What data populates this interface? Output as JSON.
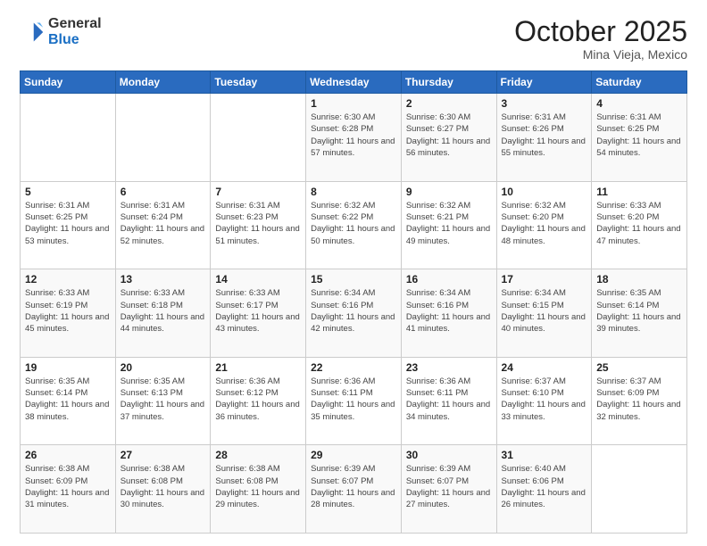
{
  "logo": {
    "general": "General",
    "blue": "Blue"
  },
  "header": {
    "month": "October 2025",
    "location": "Mina Vieja, Mexico"
  },
  "weekdays": [
    "Sunday",
    "Monday",
    "Tuesday",
    "Wednesday",
    "Thursday",
    "Friday",
    "Saturday"
  ],
  "weeks": [
    [
      {
        "day": "",
        "sunrise": "",
        "sunset": "",
        "daylight": ""
      },
      {
        "day": "",
        "sunrise": "",
        "sunset": "",
        "daylight": ""
      },
      {
        "day": "",
        "sunrise": "",
        "sunset": "",
        "daylight": ""
      },
      {
        "day": "1",
        "sunrise": "Sunrise: 6:30 AM",
        "sunset": "Sunset: 6:28 PM",
        "daylight": "Daylight: 11 hours and 57 minutes."
      },
      {
        "day": "2",
        "sunrise": "Sunrise: 6:30 AM",
        "sunset": "Sunset: 6:27 PM",
        "daylight": "Daylight: 11 hours and 56 minutes."
      },
      {
        "day": "3",
        "sunrise": "Sunrise: 6:31 AM",
        "sunset": "Sunset: 6:26 PM",
        "daylight": "Daylight: 11 hours and 55 minutes."
      },
      {
        "day": "4",
        "sunrise": "Sunrise: 6:31 AM",
        "sunset": "Sunset: 6:25 PM",
        "daylight": "Daylight: 11 hours and 54 minutes."
      }
    ],
    [
      {
        "day": "5",
        "sunrise": "Sunrise: 6:31 AM",
        "sunset": "Sunset: 6:25 PM",
        "daylight": "Daylight: 11 hours and 53 minutes."
      },
      {
        "day": "6",
        "sunrise": "Sunrise: 6:31 AM",
        "sunset": "Sunset: 6:24 PM",
        "daylight": "Daylight: 11 hours and 52 minutes."
      },
      {
        "day": "7",
        "sunrise": "Sunrise: 6:31 AM",
        "sunset": "Sunset: 6:23 PM",
        "daylight": "Daylight: 11 hours and 51 minutes."
      },
      {
        "day": "8",
        "sunrise": "Sunrise: 6:32 AM",
        "sunset": "Sunset: 6:22 PM",
        "daylight": "Daylight: 11 hours and 50 minutes."
      },
      {
        "day": "9",
        "sunrise": "Sunrise: 6:32 AM",
        "sunset": "Sunset: 6:21 PM",
        "daylight": "Daylight: 11 hours and 49 minutes."
      },
      {
        "day": "10",
        "sunrise": "Sunrise: 6:32 AM",
        "sunset": "Sunset: 6:20 PM",
        "daylight": "Daylight: 11 hours and 48 minutes."
      },
      {
        "day": "11",
        "sunrise": "Sunrise: 6:33 AM",
        "sunset": "Sunset: 6:20 PM",
        "daylight": "Daylight: 11 hours and 47 minutes."
      }
    ],
    [
      {
        "day": "12",
        "sunrise": "Sunrise: 6:33 AM",
        "sunset": "Sunset: 6:19 PM",
        "daylight": "Daylight: 11 hours and 45 minutes."
      },
      {
        "day": "13",
        "sunrise": "Sunrise: 6:33 AM",
        "sunset": "Sunset: 6:18 PM",
        "daylight": "Daylight: 11 hours and 44 minutes."
      },
      {
        "day": "14",
        "sunrise": "Sunrise: 6:33 AM",
        "sunset": "Sunset: 6:17 PM",
        "daylight": "Daylight: 11 hours and 43 minutes."
      },
      {
        "day": "15",
        "sunrise": "Sunrise: 6:34 AM",
        "sunset": "Sunset: 6:16 PM",
        "daylight": "Daylight: 11 hours and 42 minutes."
      },
      {
        "day": "16",
        "sunrise": "Sunrise: 6:34 AM",
        "sunset": "Sunset: 6:16 PM",
        "daylight": "Daylight: 11 hours and 41 minutes."
      },
      {
        "day": "17",
        "sunrise": "Sunrise: 6:34 AM",
        "sunset": "Sunset: 6:15 PM",
        "daylight": "Daylight: 11 hours and 40 minutes."
      },
      {
        "day": "18",
        "sunrise": "Sunrise: 6:35 AM",
        "sunset": "Sunset: 6:14 PM",
        "daylight": "Daylight: 11 hours and 39 minutes."
      }
    ],
    [
      {
        "day": "19",
        "sunrise": "Sunrise: 6:35 AM",
        "sunset": "Sunset: 6:14 PM",
        "daylight": "Daylight: 11 hours and 38 minutes."
      },
      {
        "day": "20",
        "sunrise": "Sunrise: 6:35 AM",
        "sunset": "Sunset: 6:13 PM",
        "daylight": "Daylight: 11 hours and 37 minutes."
      },
      {
        "day": "21",
        "sunrise": "Sunrise: 6:36 AM",
        "sunset": "Sunset: 6:12 PM",
        "daylight": "Daylight: 11 hours and 36 minutes."
      },
      {
        "day": "22",
        "sunrise": "Sunrise: 6:36 AM",
        "sunset": "Sunset: 6:11 PM",
        "daylight": "Daylight: 11 hours and 35 minutes."
      },
      {
        "day": "23",
        "sunrise": "Sunrise: 6:36 AM",
        "sunset": "Sunset: 6:11 PM",
        "daylight": "Daylight: 11 hours and 34 minutes."
      },
      {
        "day": "24",
        "sunrise": "Sunrise: 6:37 AM",
        "sunset": "Sunset: 6:10 PM",
        "daylight": "Daylight: 11 hours and 33 minutes."
      },
      {
        "day": "25",
        "sunrise": "Sunrise: 6:37 AM",
        "sunset": "Sunset: 6:09 PM",
        "daylight": "Daylight: 11 hours and 32 minutes."
      }
    ],
    [
      {
        "day": "26",
        "sunrise": "Sunrise: 6:38 AM",
        "sunset": "Sunset: 6:09 PM",
        "daylight": "Daylight: 11 hours and 31 minutes."
      },
      {
        "day": "27",
        "sunrise": "Sunrise: 6:38 AM",
        "sunset": "Sunset: 6:08 PM",
        "daylight": "Daylight: 11 hours and 30 minutes."
      },
      {
        "day": "28",
        "sunrise": "Sunrise: 6:38 AM",
        "sunset": "Sunset: 6:08 PM",
        "daylight": "Daylight: 11 hours and 29 minutes."
      },
      {
        "day": "29",
        "sunrise": "Sunrise: 6:39 AM",
        "sunset": "Sunset: 6:07 PM",
        "daylight": "Daylight: 11 hours and 28 minutes."
      },
      {
        "day": "30",
        "sunrise": "Sunrise: 6:39 AM",
        "sunset": "Sunset: 6:07 PM",
        "daylight": "Daylight: 11 hours and 27 minutes."
      },
      {
        "day": "31",
        "sunrise": "Sunrise: 6:40 AM",
        "sunset": "Sunset: 6:06 PM",
        "daylight": "Daylight: 11 hours and 26 minutes."
      },
      {
        "day": "",
        "sunrise": "",
        "sunset": "",
        "daylight": ""
      }
    ]
  ]
}
